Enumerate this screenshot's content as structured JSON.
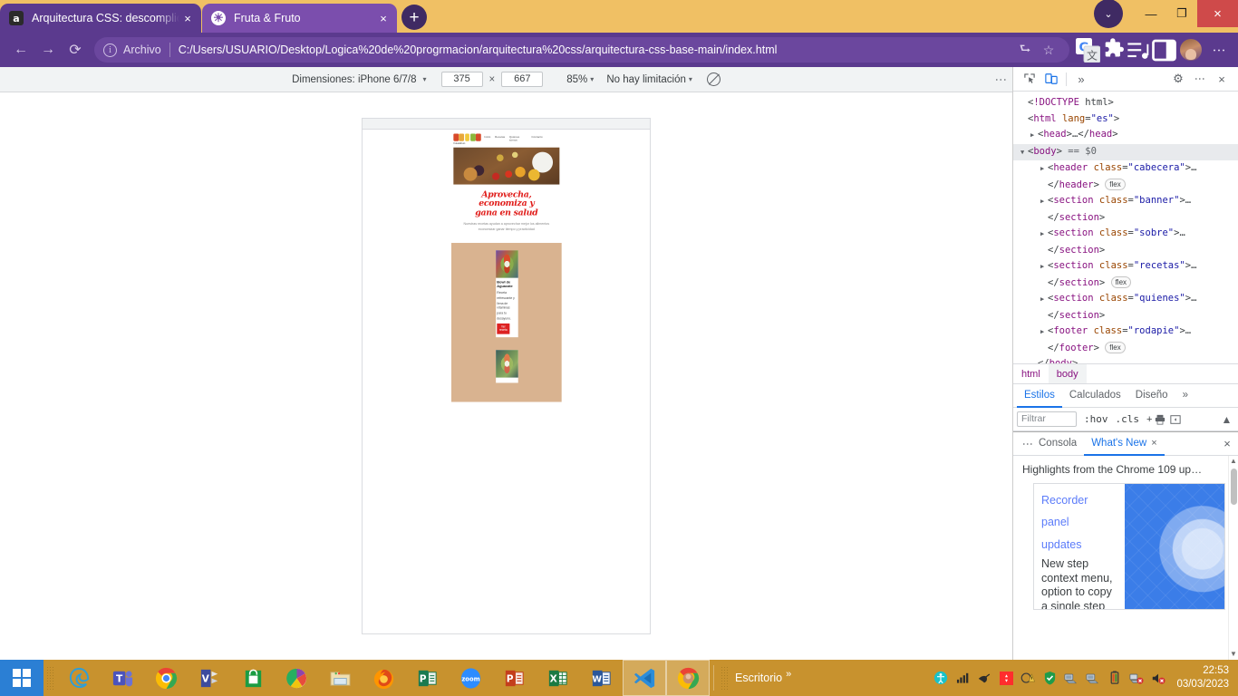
{
  "browser": {
    "tabs": [
      {
        "title": "Arquitectura CSS: descomplicand",
        "favicon": "amazon-icon",
        "active": false,
        "close_label": "×"
      },
      {
        "title": "Fruta & Fruto",
        "favicon": "globe-icon",
        "active": true,
        "close_label": "×"
      }
    ],
    "new_tab_label": "+",
    "tab_search_label": "⌄",
    "window_controls": {
      "minimize": "—",
      "maximize": "❐",
      "close": "×"
    },
    "nav": {
      "back": "←",
      "forward": "→",
      "reload": "⟳"
    },
    "omnibox": {
      "info_icon": "i",
      "scheme_label": "Archivo",
      "url": "C:/Users/USUARIO/Desktop/Logica%20de%20progrmacion/arquitectura%20css/arquitectura-css-base-main/index.html",
      "share_icon": "⮑",
      "bookmark_icon": "☆"
    },
    "toolbar_icons": [
      "translate-icon",
      "extensions-icon",
      "media-icon",
      "sidepanel-icon",
      "profile-avatar",
      "chrome-menu-icon"
    ],
    "menu_label": "⋮"
  },
  "device_toolbar": {
    "dimensions_label": "Dimensiones: iPhone 6/7/8",
    "width": "375",
    "height": "667",
    "multiply": "×",
    "zoom": "85%",
    "throttling": "No hay limitación",
    "caret": "▾",
    "kebab": "⋮"
  },
  "devtools": {
    "header_icons": {
      "inspect": "inspect-cursor-icon",
      "device": "device-toggle-icon",
      "overflow": "»",
      "settings": "⚙",
      "kebab": "⋮",
      "close": "×"
    },
    "dom_lines": [
      {
        "indent": 0,
        "arrow": "",
        "text": "<!DOCTYPE html>",
        "kind": "doctype"
      },
      {
        "indent": 0,
        "arrow": "",
        "text": "<html lang=\"es\">",
        "kind": "open"
      },
      {
        "indent": 1,
        "arrow": "▶",
        "text": "<head>…</head>",
        "kind": "collapsed"
      },
      {
        "indent": 0,
        "arrow": "▼",
        "text": "<body> == $0",
        "kind": "selected"
      },
      {
        "indent": 2,
        "arrow": "▶",
        "text": "<header class=\"cabecera\">…",
        "kind": "collapsed"
      },
      {
        "indent": 2,
        "arrow": "",
        "text": "</header>",
        "badge": "flex",
        "kind": "close"
      },
      {
        "indent": 2,
        "arrow": "▶",
        "text": "<section class=\"banner\">…",
        "kind": "collapsed"
      },
      {
        "indent": 2,
        "arrow": "",
        "text": "</section>",
        "kind": "close"
      },
      {
        "indent": 2,
        "arrow": "▶",
        "text": "<section class=\"sobre\">…",
        "kind": "collapsed"
      },
      {
        "indent": 2,
        "arrow": "",
        "text": "</section>",
        "kind": "close"
      },
      {
        "indent": 2,
        "arrow": "▶",
        "text": "<section class=\"recetas\">…",
        "kind": "collapsed"
      },
      {
        "indent": 2,
        "arrow": "",
        "text": "</section>",
        "badge": "flex",
        "kind": "close"
      },
      {
        "indent": 2,
        "arrow": "▶",
        "text": "<section class=\"quienes\">…",
        "kind": "collapsed"
      },
      {
        "indent": 2,
        "arrow": "",
        "text": "</section>",
        "kind": "close"
      },
      {
        "indent": 2,
        "arrow": "▶",
        "text": "<footer class=\"rodapie\">…",
        "kind": "collapsed"
      },
      {
        "indent": 2,
        "arrow": "",
        "text": "</footer>",
        "badge": "flex",
        "kind": "close"
      },
      {
        "indent": 1,
        "arrow": "",
        "text": "</body>",
        "kind": "close"
      },
      {
        "indent": 0,
        "arrow": "",
        "text": "</html>",
        "kind": "close"
      }
    ],
    "breadcrumbs": [
      "html",
      "body"
    ],
    "styles_tabs": [
      "Estilos",
      "Calculados",
      "Diseño"
    ],
    "styles_overflow": "»",
    "filter_placeholder": "Filtrar",
    "hov_label": ":hov",
    "cls_label": ".cls",
    "add_rule": "+",
    "drawer": {
      "kebab": "⋮",
      "tabs": [
        {
          "label": "Consola",
          "active": false,
          "closable": false
        },
        {
          "label": "What's New",
          "active": true,
          "closable": true,
          "close": "×"
        }
      ],
      "close": "×"
    },
    "whats_new": {
      "heading": "Highlights from the Chrome 109 up…",
      "links": [
        "Recorder",
        "panel",
        "updates"
      ],
      "body": "New step context menu, option to copy a single step"
    }
  },
  "site": {
    "logo_text": "fruta&fruto",
    "nav": [
      "Inicio",
      "Recetas",
      "Quiénes somos",
      "Contacto"
    ],
    "banner_alt": "verduras-frescas-banner",
    "sobre": {
      "title_lines": [
        "Aprovecha,",
        "economiza y",
        "gana en salud"
      ],
      "text": "Nuestras recetas ayudan a aprovechar mejor los alimentos economizar ganar tiempo y practicidad"
    },
    "recetas": [
      {
        "image": "bowl-aguacate-img",
        "title": "Bowl de Aguacate",
        "description": "Receta refrescante y llena de vitaminas para tu desayuno.",
        "button": "Ver receta"
      },
      {
        "image": "bowl-segunda-receta-img",
        "title": "",
        "description": "",
        "button": ""
      }
    ]
  },
  "taskbar": {
    "start_label": "start-button",
    "apps": [
      {
        "name": "edge-icon",
        "glyph": "e"
      },
      {
        "name": "teams-icon",
        "glyph": "T"
      },
      {
        "name": "chrome-icon",
        "glyph": ""
      },
      {
        "name": "visual-studio-icon",
        "glyph": "V"
      },
      {
        "name": "microsoft-store-icon",
        "glyph": ""
      },
      {
        "name": "picasa-icon",
        "glyph": ""
      },
      {
        "name": "file-explorer-icon",
        "glyph": ""
      },
      {
        "name": "firefox-icon",
        "glyph": ""
      },
      {
        "name": "publisher-icon",
        "glyph": "P"
      },
      {
        "name": "zoom-icon",
        "glyph": "zoom"
      },
      {
        "name": "powerpoint-icon",
        "glyph": "P"
      },
      {
        "name": "excel-icon",
        "glyph": "X"
      },
      {
        "name": "word-icon",
        "glyph": "W"
      },
      {
        "name": "vscode-icon",
        "glyph": ""
      },
      {
        "name": "chrome-active-icon",
        "glyph": ""
      }
    ],
    "desktop_label": "Escritorio",
    "desktop_chevron": "»",
    "tray": [
      "accessibility-icon",
      "signal-icon",
      "printer-icon",
      "recording-icon",
      "warning-icon",
      "shield-icon",
      "network-icon",
      "network2-icon",
      "battery-icon",
      "network-error-icon",
      "volume-mute-icon"
    ],
    "clock_time": "22:53",
    "clock_date": "03/03/2023"
  }
}
